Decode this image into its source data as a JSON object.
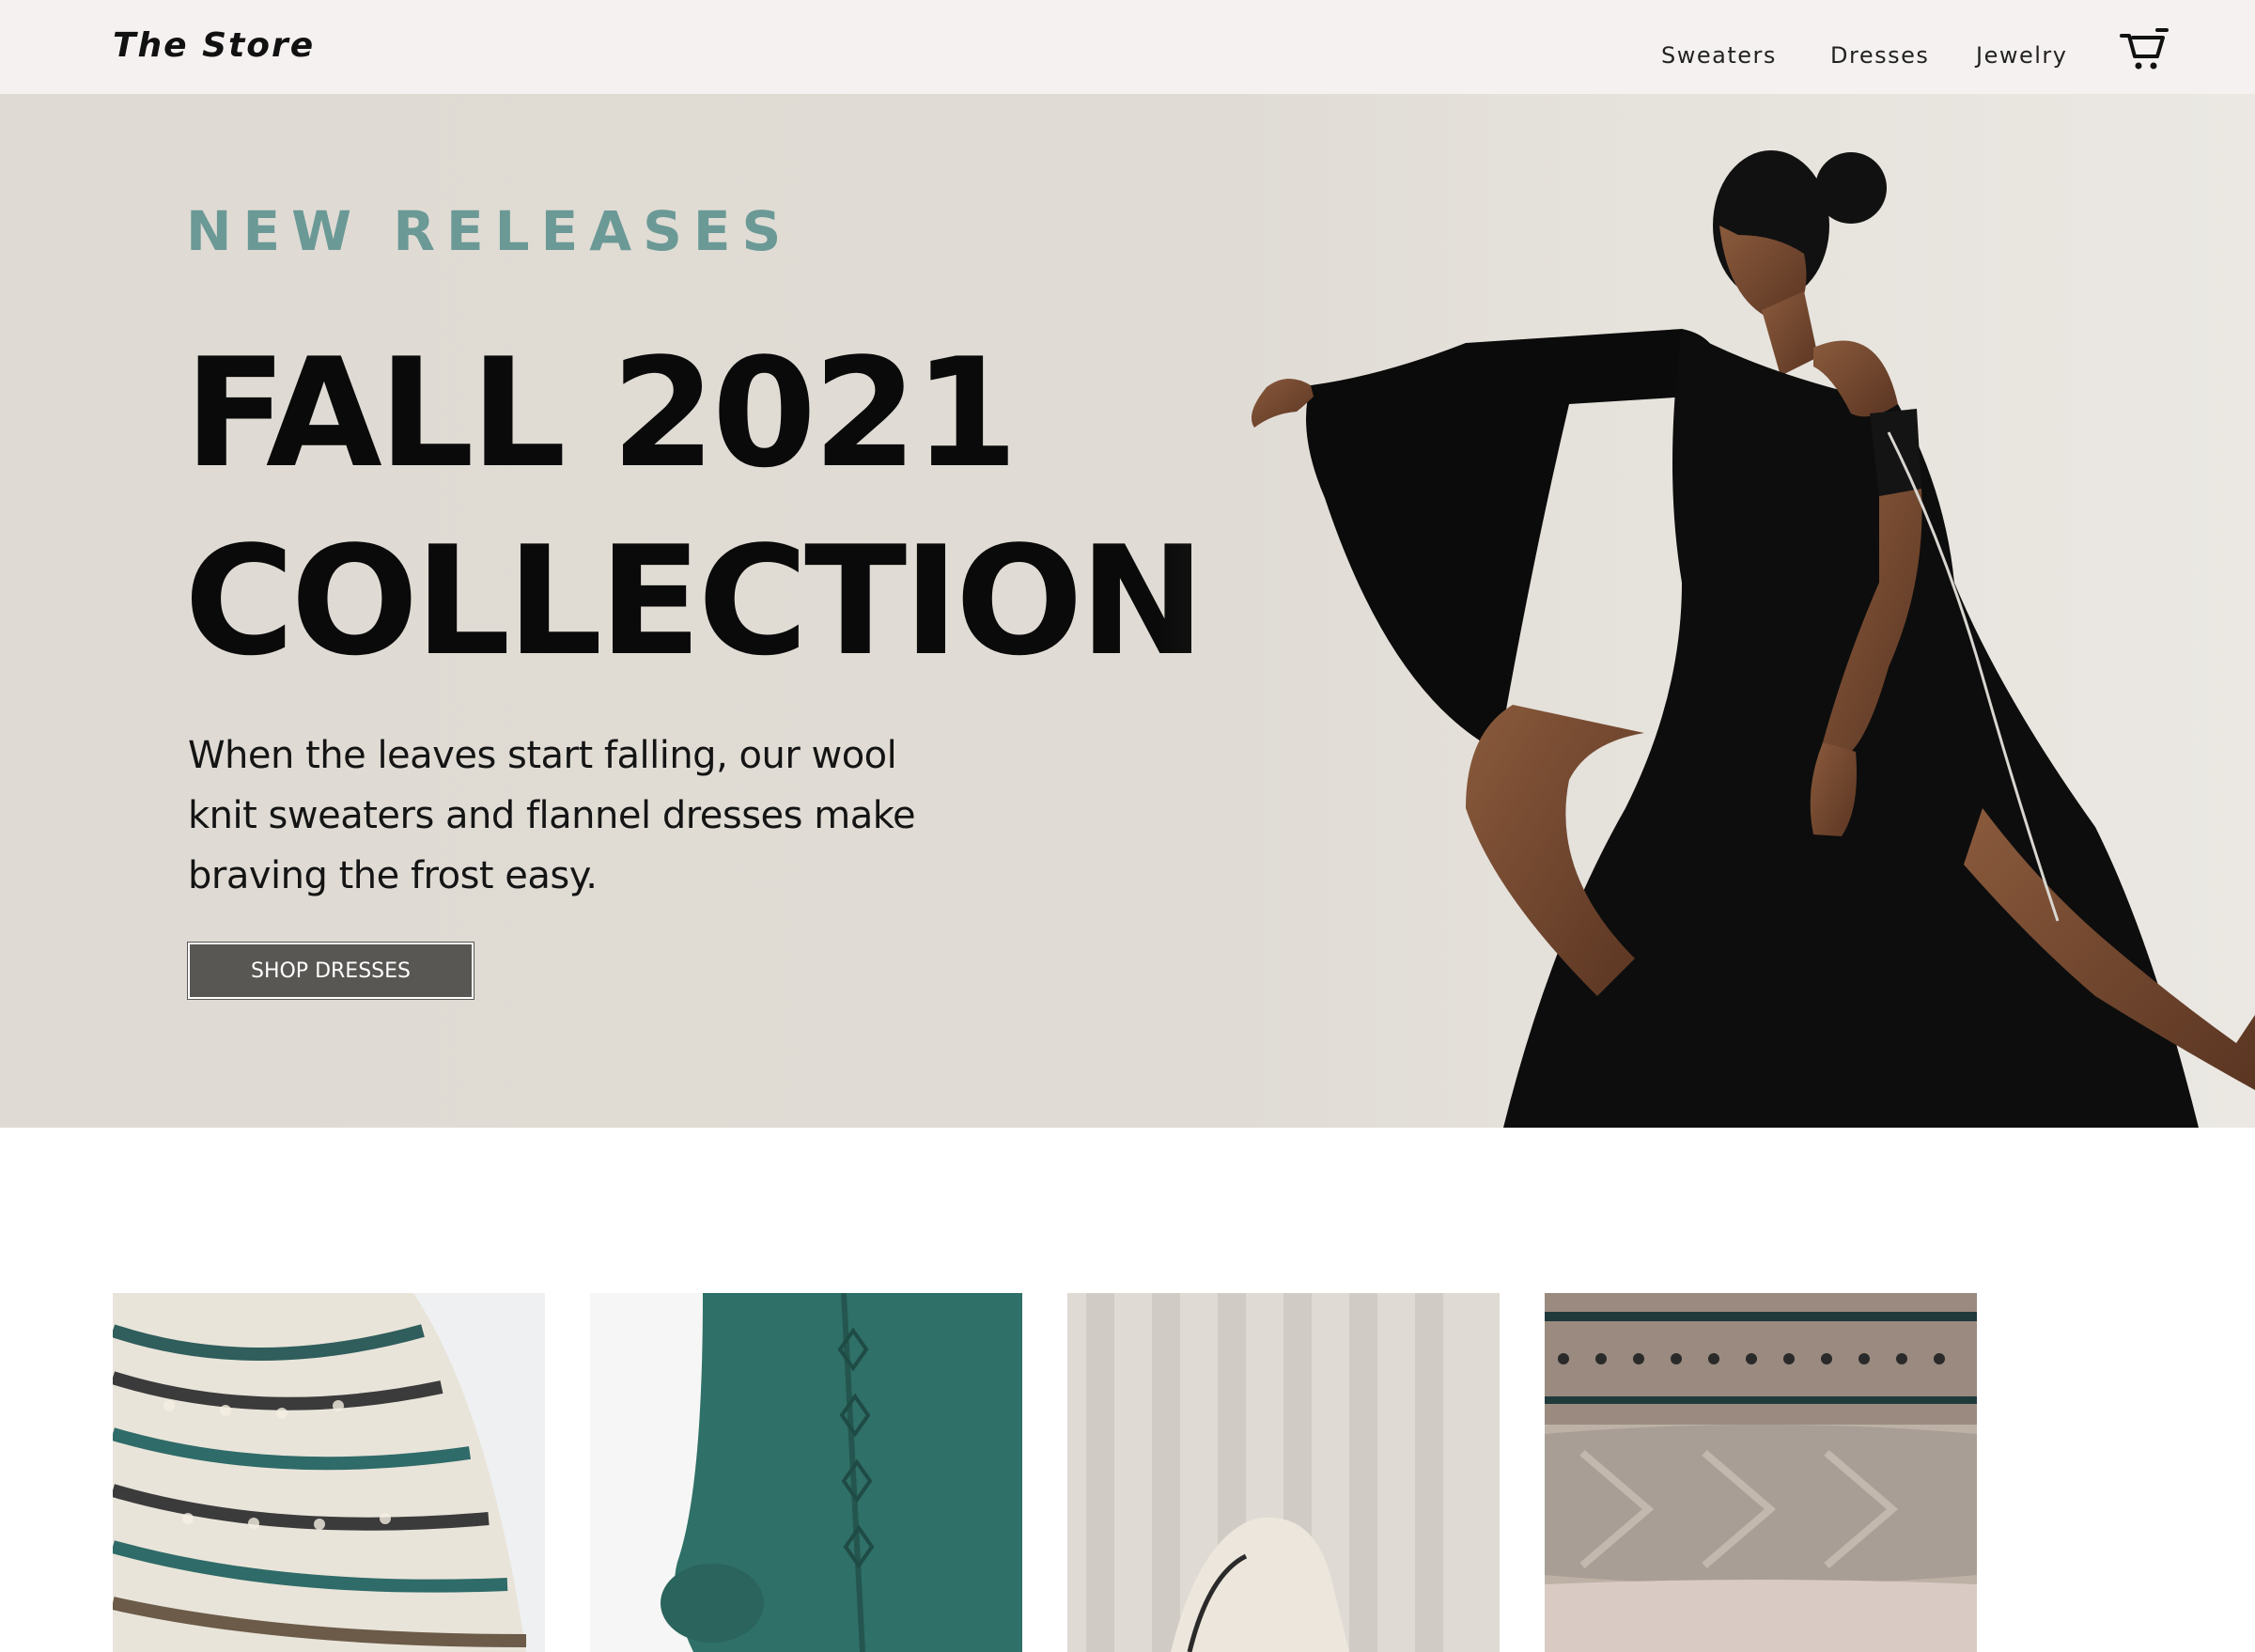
{
  "header": {
    "brand": "The Store",
    "nav": [
      {
        "label": "Sweaters"
      },
      {
        "label": "Dresses"
      },
      {
        "label": "Jewelry"
      }
    ],
    "cart_icon": "cart-icon"
  },
  "hero": {
    "eyebrow": "NEW RELEASES",
    "headline_line1": "FALL 2021",
    "headline_line2": "COLLECTION",
    "body": "When the leaves start falling, our wool knit sweaters and flannel dresses make braving the frost easy.",
    "cta_label": "SHOP DRESSES",
    "image": "model-in-black-dress-photo"
  },
  "products": [
    {
      "image": "fair-isle-sweater-photo"
    },
    {
      "image": "green-knit-cardigan-photo"
    },
    {
      "image": "cream-knit-on-chair-photo"
    },
    {
      "image": "folded-knit-sweaters-photo"
    }
  ],
  "colors": {
    "header_bg": "#f5f1f0",
    "hero_bg": "#dfdbd4",
    "accent_teal": "#6b9996",
    "button_bg": "#595754"
  }
}
